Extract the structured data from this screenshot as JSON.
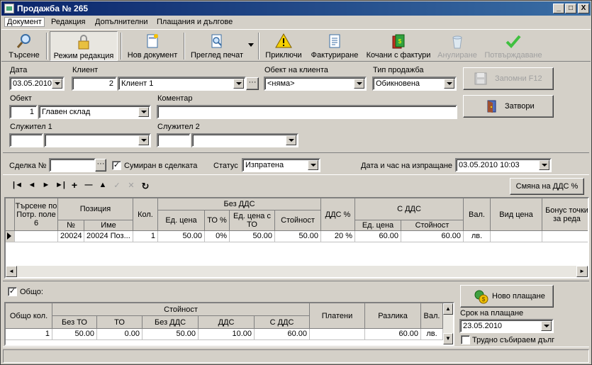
{
  "window": {
    "title": "Продажба № 265",
    "min": "_",
    "max": "□",
    "close": "X"
  },
  "menu": [
    "Документ",
    "Редакция",
    "Допълнителни",
    "Плащания и дългове"
  ],
  "toolbar": {
    "search": "Търсене",
    "edit_mode": "Режим редакция",
    "new_doc": "Нов документ",
    "print_preview": "Преглед печат",
    "close_doc": "Приключи",
    "invoicing": "Фактуриране",
    "linked_invoices": "Кочани с фактури",
    "cancel": "Анулиране",
    "confirm": "Потвърждаване"
  },
  "form": {
    "date_label": "Дата",
    "date_value": "03.05.2010",
    "client_label": "Клиент",
    "client_id": "2",
    "client_name": "Клиент 1",
    "client_obj_label": "Обект на клиента",
    "client_obj_value": "<няма>",
    "sale_type_label": "Тип продажба",
    "sale_type_value": "Обикновена",
    "object_label": "Обект",
    "object_id": "1",
    "object_name": "Главен склад",
    "comment_label": "Коментар",
    "comment_value": "",
    "emp1_label": "Служител 1",
    "emp2_label": "Служител 2",
    "save_button": "Запомни  F12",
    "close_button": "Затвори"
  },
  "deal": {
    "deal_label": "Сделка №",
    "deal_value": "",
    "summed_label": "Сумиран в сделката",
    "status_label": "Статус",
    "status_value": "Изпратена",
    "sent_label": "Дата и час на изпращане",
    "sent_value": "03.05.2010 10:03"
  },
  "grid_toolbar": {
    "nav": [
      "|◄",
      "◄",
      "►",
      "►|",
      "+",
      "—",
      "▲",
      "✓",
      "✕",
      "↻"
    ],
    "vat_change": "Смяна на ДДС %"
  },
  "grid": {
    "headers": {
      "search_by": "Търсене по Потр. поле 6",
      "position": "Позиция",
      "pos_no": "№",
      "pos_name": "Име",
      "qty": "Кол.",
      "no_vat": "Без ДДС",
      "unit_price": "Ед. цена",
      "to_pct": "ТО %",
      "unit_price_to": "Ед. цена с ТО",
      "value": "Стойност",
      "vat_pct": "ДДС %",
      "with_vat": "С ДДС",
      "wv_unit_price": "Ед. цена",
      "wv_value": "Стойност",
      "currency": "Вал.",
      "price_type": "Вид цена",
      "bonus": "Бонус точки за реда"
    },
    "rows": [
      {
        "search": "",
        "no": "20024",
        "name": "20024 Поз...",
        "qty": "1",
        "unit_price": "50.00",
        "to_pct": "0%",
        "unit_price_to": "50.00",
        "value": "50.00",
        "vat_pct": "20 %",
        "wv_unit_price": "60.00",
        "wv_value": "60.00",
        "currency": "лв.",
        "price_type": "",
        "bonus": ""
      }
    ]
  },
  "totals": {
    "all_label": "Общо:",
    "headers": {
      "total_qty": "Общо кол.",
      "value": "Стойност",
      "no_to": "Без ТО",
      "to": "ТО",
      "no_vat": "Без ДДС",
      "vat": "ДДС",
      "with_vat": "С ДДС",
      "paid": "Платени",
      "diff": "Разлика",
      "currency": "Вал."
    },
    "row": {
      "total_qty": "1",
      "no_to": "50.00",
      "to": "0.00",
      "no_vat": "50.00",
      "vat": "10.00",
      "with_vat": "60.00",
      "paid": "",
      "diff": "60.00",
      "currency": "лв."
    },
    "new_payment": "Ново плащане",
    "due_label": "Срок на плащане",
    "due_value": "23.05.2010",
    "hard_debt_label": "Трудно събираем дълг"
  }
}
